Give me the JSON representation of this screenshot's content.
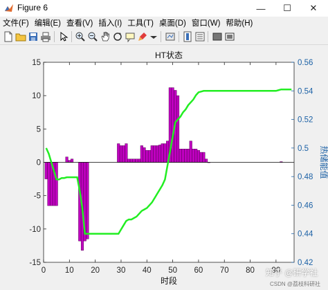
{
  "window": {
    "title": "Figure 6",
    "minimize_glyph": "—",
    "maximize_glyph": "☐",
    "close_glyph": "✕"
  },
  "menu": [
    "文件(F)",
    "编辑(E)",
    "查看(V)",
    "插入(I)",
    "工具(T)",
    "桌面(D)",
    "窗口(W)",
    "帮助(H)"
  ],
  "toolbar": {
    "icons": [
      "new-figure-icon",
      "open-file-icon",
      "save-icon",
      "print-icon",
      "select-arrow-icon",
      "zoom-in-icon",
      "zoom-out-icon",
      "pan-icon",
      "rotate-3d-icon",
      "data-cursor-icon",
      "brush-icon",
      "dropdown-arrow-icon",
      "link-plot-icon",
      "insert-colorbar-icon",
      "insert-legend-icon",
      "hide-plot-tools-icon",
      "show-plot-tools-icon"
    ]
  },
  "watermark": {
    "main": "知乎 @研学社",
    "sub": "CSDN @荔枝科研社"
  },
  "chart_data": {
    "type": "bar",
    "title": "HT状态",
    "xlabel": "时段",
    "ylabel_right": "热储能值",
    "xlim": [
      0,
      97
    ],
    "ylim_left": [
      -15,
      15
    ],
    "ylim_right": [
      0.42,
      0.56
    ],
    "xticks": [
      "0",
      "10",
      "20",
      "30",
      "40",
      "50",
      "60",
      "70",
      "80",
      "90"
    ],
    "yticks_left": [
      "-15",
      "-10",
      "-5",
      "0",
      "5",
      "10",
      "15"
    ],
    "yticks_right": [
      "0.42",
      "0.44",
      "0.46",
      "0.48",
      "0.5",
      "0.52",
      "0.54",
      "0.56"
    ],
    "bar_color": "#c000c0",
    "line_color": "#22ee22",
    "bars": {
      "x": [
        1,
        2,
        3,
        4,
        5,
        9,
        10,
        11,
        14,
        15,
        16,
        17,
        29,
        30,
        31,
        32,
        33,
        34,
        35,
        36,
        37,
        38,
        39,
        40,
        41,
        42,
        43,
        44,
        45,
        46,
        47,
        48,
        49,
        50,
        51,
        52,
        53,
        54,
        55,
        56,
        57,
        58,
        59,
        60,
        61,
        62,
        63,
        64,
        92
      ],
      "values": [
        -2.5,
        -6.5,
        -6.5,
        -6.5,
        -6.5,
        0.8,
        0.3,
        0.5,
        -11.8,
        -13.2,
        -11.8,
        -11.5,
        2.8,
        2.5,
        2.5,
        2.8,
        0.5,
        0.5,
        0.5,
        0.5,
        0.5,
        2.5,
        2.2,
        1.8,
        1.8,
        2.5,
        2.5,
        2.5,
        2.6,
        2.8,
        2.8,
        3.2,
        11.2,
        11.2,
        10.8,
        10.0,
        2.0,
        2.0,
        2.0,
        2.0,
        3.2,
        2.0,
        2.0,
        1.8,
        1.5,
        1.5,
        0.5,
        0.0,
        0.1
      ]
    },
    "line": {
      "x": [
        1,
        2,
        3,
        4,
        5,
        6,
        7,
        8,
        9,
        10,
        11,
        12,
        13,
        14,
        15,
        16,
        17,
        18,
        19,
        20,
        21,
        22,
        23,
        24,
        25,
        26,
        27,
        28,
        29,
        30,
        31,
        32,
        33,
        34,
        35,
        36,
        37,
        38,
        39,
        40,
        41,
        42,
        43,
        44,
        45,
        46,
        47,
        48,
        49,
        50,
        51,
        52,
        53,
        54,
        55,
        56,
        57,
        58,
        59,
        60,
        61,
        62,
        63,
        64,
        65,
        66,
        67,
        68,
        69,
        70,
        71,
        72,
        73,
        74,
        75,
        76,
        77,
        78,
        79,
        80,
        81,
        82,
        83,
        84,
        85,
        86,
        87,
        88,
        89,
        90,
        91,
        92,
        93,
        94,
        95,
        96
      ],
      "values": [
        0.5,
        0.496,
        0.49,
        0.484,
        0.478,
        0.478,
        0.479,
        0.479,
        0.4795,
        0.4795,
        0.4795,
        0.4795,
        0.4795,
        0.47,
        0.458,
        0.44,
        0.44,
        0.44,
        0.44,
        0.44,
        0.44,
        0.44,
        0.44,
        0.44,
        0.44,
        0.44,
        0.44,
        0.44,
        0.44,
        0.443,
        0.446,
        0.449,
        0.45,
        0.45,
        0.451,
        0.452,
        0.454,
        0.456,
        0.457,
        0.458,
        0.46,
        0.462,
        0.465,
        0.468,
        0.471,
        0.474,
        0.478,
        0.488,
        0.498,
        0.508,
        0.518,
        0.52,
        0.522,
        0.525,
        0.527,
        0.53,
        0.532,
        0.534,
        0.537,
        0.539,
        0.5395,
        0.54,
        0.54,
        0.54,
        0.54,
        0.54,
        0.54,
        0.54,
        0.54,
        0.54,
        0.54,
        0.54,
        0.54,
        0.54,
        0.54,
        0.54,
        0.54,
        0.54,
        0.54,
        0.54,
        0.54,
        0.54,
        0.54,
        0.54,
        0.54,
        0.54,
        0.54,
        0.54,
        0.54,
        0.54,
        0.5405,
        0.541,
        0.541,
        0.541,
        0.541,
        0.541
      ]
    }
  }
}
